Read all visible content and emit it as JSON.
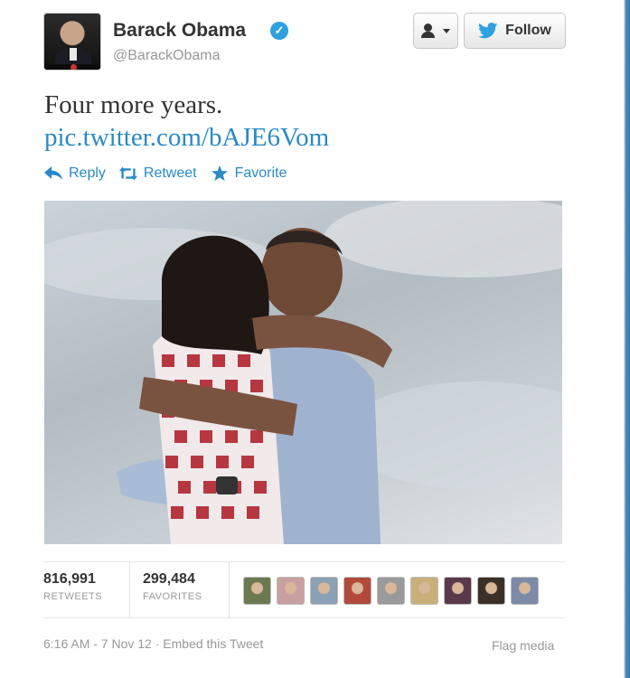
{
  "author": {
    "name": "Barack Obama",
    "handle": "@BarackObama",
    "verified_glyph": "✓"
  },
  "buttons": {
    "follow_label": "Follow"
  },
  "tweet": {
    "text": "Four more years.",
    "link": "pic.twitter.com/bAJE6Vom"
  },
  "actions": {
    "reply": "Reply",
    "retweet": "Retweet",
    "favorite": "Favorite"
  },
  "stats": {
    "retweets_count": "816,991",
    "retweets_label": "RETWEETS",
    "favorites_count": "299,484",
    "favorites_label": "FAVORITES"
  },
  "favoriter_avatars": [
    {
      "color": "#6c7a52"
    },
    {
      "color": "#c9a0a0"
    },
    {
      "color": "#8aa0b5"
    },
    {
      "color": "#b24a3c"
    },
    {
      "color": "#9a9a9a"
    },
    {
      "color": "#c9b07a"
    },
    {
      "color": "#5a3a4a"
    },
    {
      "color": "#3a3028"
    },
    {
      "color": "#7c8aa8"
    }
  ],
  "footer": {
    "timestamp": "6:16 AM - 7 Nov 12",
    "separator": " · ",
    "embed": "Embed this Tweet",
    "flag": "Flag media"
  },
  "colors": {
    "link": "#2a8ac8",
    "muted": "#999999",
    "verified": "#2ea1e0",
    "twitter_blue": "#2ea1e0"
  }
}
